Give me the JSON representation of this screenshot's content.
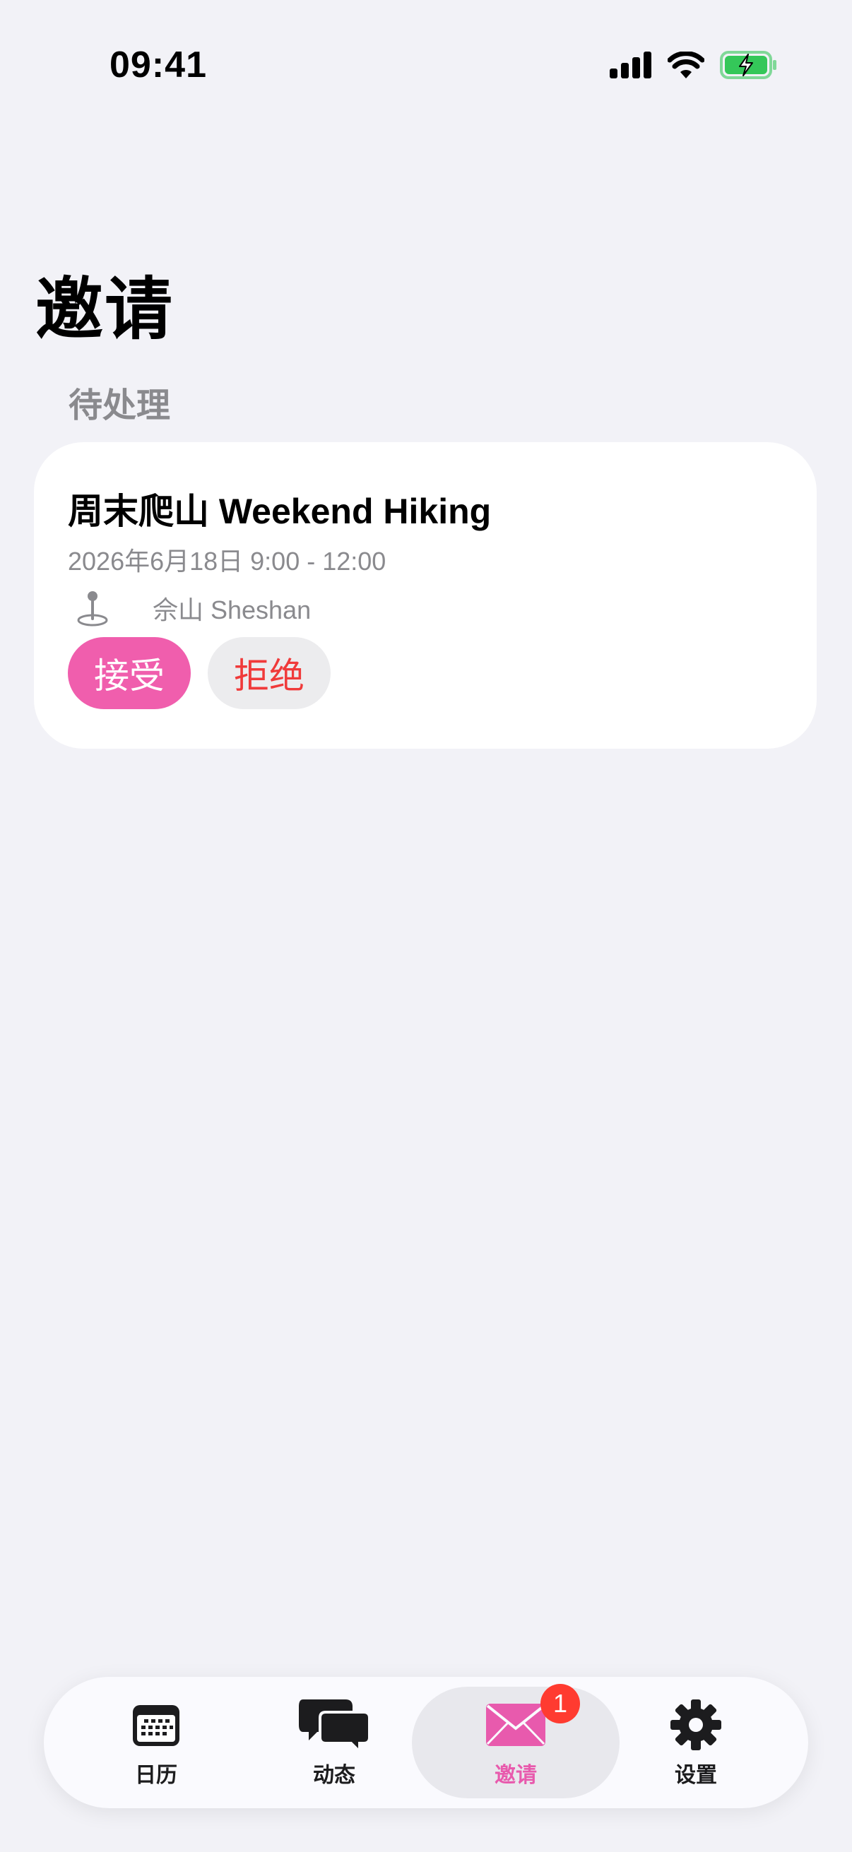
{
  "status_bar": {
    "time": "09:41",
    "icons": [
      "signal-icon",
      "wifi-icon",
      "battery-charging-icon"
    ],
    "battery_color": "#34c759"
  },
  "page": {
    "title": "邀请",
    "section_header": "待处理"
  },
  "invite": {
    "title": "周末爬山 Weekend Hiking",
    "time": "2026年6月18日 9:00 - 12:00",
    "location": "佘山 Sheshan",
    "accept_label": "接受",
    "decline_label": "拒绝",
    "accept_color": "#f05ead",
    "decline_color": "#f03a3a"
  },
  "tab_bar": {
    "active_color": "#e85aad",
    "tabs": [
      {
        "label": "日历",
        "icon": "calendar-icon"
      },
      {
        "label": "动态",
        "icon": "chat-bubbles-icon"
      },
      {
        "label": "邀请",
        "icon": "envelope-icon",
        "badge": "1",
        "active": true
      },
      {
        "label": "设置",
        "icon": "gear-icon"
      }
    ]
  }
}
